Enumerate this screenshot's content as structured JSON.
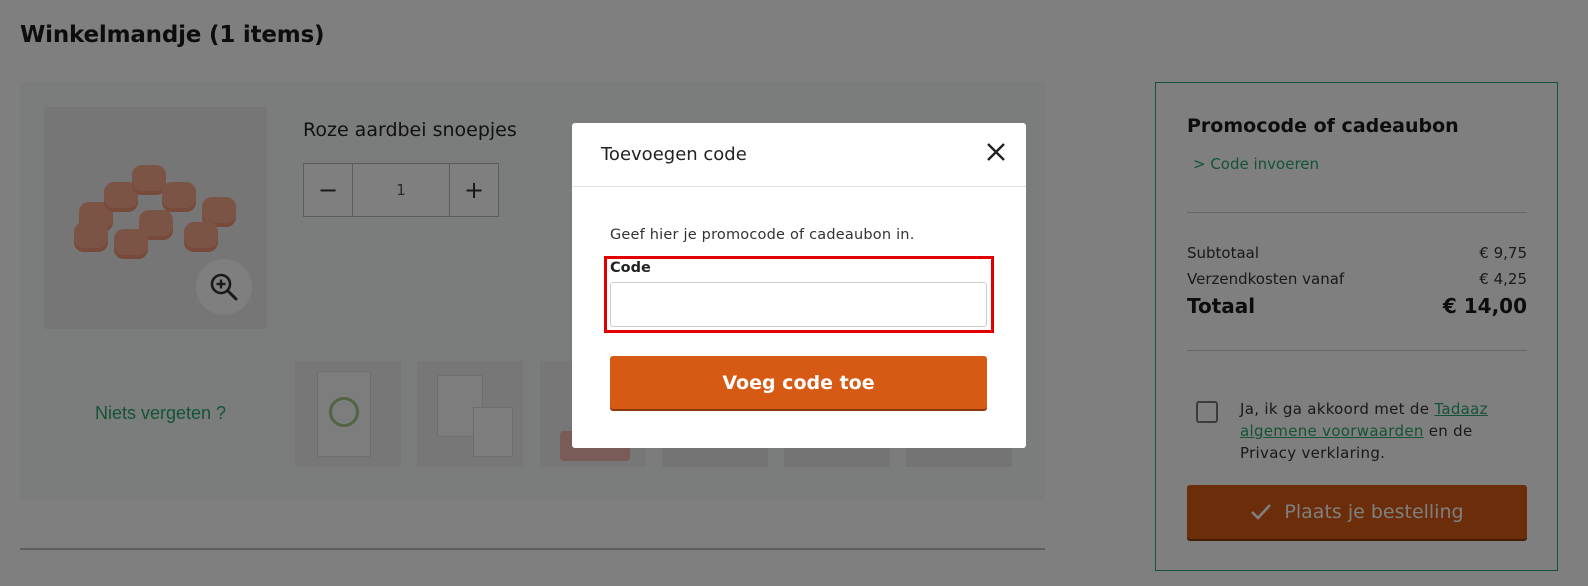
{
  "page": {
    "title": "Winkelmandje  (1 items)"
  },
  "cart": {
    "product": {
      "name": "Roze aardbei snoepjes",
      "quantity": "1",
      "decrement_label": "−",
      "increment_label": "+",
      "zoom_icon": "zoom-in-icon"
    },
    "reminder_label": "Niets vergeten ?"
  },
  "sidebar": {
    "promo_title": "Promocode of cadeaubon",
    "promo_link": "> Code invoeren",
    "subtotal_label": "Subtotaal",
    "subtotal_value": "€ 9,75",
    "shipping_label": "Verzendkosten vanaf",
    "shipping_value": "€ 4,25",
    "total_label": "Totaal",
    "total_value": "€ 14,00",
    "terms_prefix": "Ja, ik ga akkoord met de ",
    "terms_link": "Tadaaz algemene voorwaarden",
    "terms_suffix": " en de Privacy verklaring.",
    "place_order_label": "Plaats je bestelling"
  },
  "modal": {
    "title": "Toevoegen code",
    "description": "Geef hier je promocode of cadeaubon in.",
    "code_label": "Code",
    "code_value": "",
    "submit_label": "Voeg code toe"
  },
  "colors": {
    "accent_green": "#2aa66a",
    "button_orange": "#d75a14",
    "highlight_red": "#e00000"
  }
}
